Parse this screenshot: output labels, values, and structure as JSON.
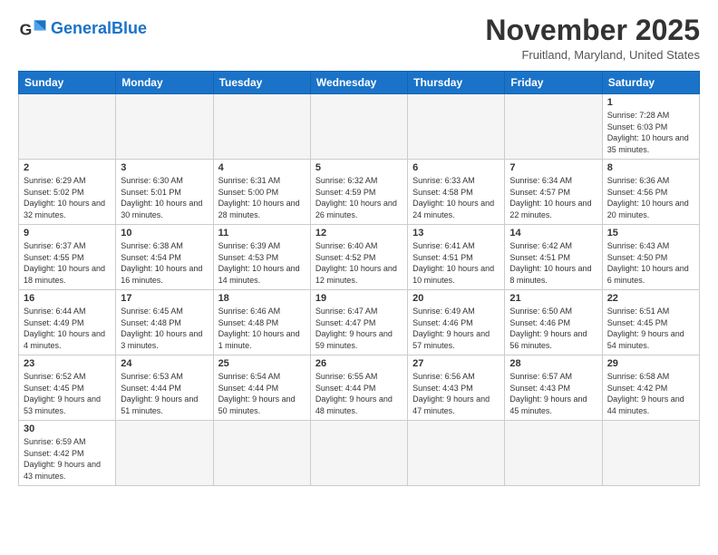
{
  "header": {
    "logo_general": "General",
    "logo_blue": "Blue",
    "month_title": "November 2025",
    "location": "Fruitland, Maryland, United States"
  },
  "weekdays": [
    "Sunday",
    "Monday",
    "Tuesday",
    "Wednesday",
    "Thursday",
    "Friday",
    "Saturday"
  ],
  "weeks": [
    [
      {
        "day": "",
        "info": ""
      },
      {
        "day": "",
        "info": ""
      },
      {
        "day": "",
        "info": ""
      },
      {
        "day": "",
        "info": ""
      },
      {
        "day": "",
        "info": ""
      },
      {
        "day": "",
        "info": ""
      },
      {
        "day": "1",
        "info": "Sunrise: 7:28 AM\nSunset: 6:03 PM\nDaylight: 10 hours\nand 35 minutes."
      }
    ],
    [
      {
        "day": "2",
        "info": "Sunrise: 6:29 AM\nSunset: 5:02 PM\nDaylight: 10 hours\nand 32 minutes."
      },
      {
        "day": "3",
        "info": "Sunrise: 6:30 AM\nSunset: 5:01 PM\nDaylight: 10 hours\nand 30 minutes."
      },
      {
        "day": "4",
        "info": "Sunrise: 6:31 AM\nSunset: 5:00 PM\nDaylight: 10 hours\nand 28 minutes."
      },
      {
        "day": "5",
        "info": "Sunrise: 6:32 AM\nSunset: 4:59 PM\nDaylight: 10 hours\nand 26 minutes."
      },
      {
        "day": "6",
        "info": "Sunrise: 6:33 AM\nSunset: 4:58 PM\nDaylight: 10 hours\nand 24 minutes."
      },
      {
        "day": "7",
        "info": "Sunrise: 6:34 AM\nSunset: 4:57 PM\nDaylight: 10 hours\nand 22 minutes."
      },
      {
        "day": "8",
        "info": "Sunrise: 6:36 AM\nSunset: 4:56 PM\nDaylight: 10 hours\nand 20 minutes."
      }
    ],
    [
      {
        "day": "9",
        "info": "Sunrise: 6:37 AM\nSunset: 4:55 PM\nDaylight: 10 hours\nand 18 minutes."
      },
      {
        "day": "10",
        "info": "Sunrise: 6:38 AM\nSunset: 4:54 PM\nDaylight: 10 hours\nand 16 minutes."
      },
      {
        "day": "11",
        "info": "Sunrise: 6:39 AM\nSunset: 4:53 PM\nDaylight: 10 hours\nand 14 minutes."
      },
      {
        "day": "12",
        "info": "Sunrise: 6:40 AM\nSunset: 4:52 PM\nDaylight: 10 hours\nand 12 minutes."
      },
      {
        "day": "13",
        "info": "Sunrise: 6:41 AM\nSunset: 4:51 PM\nDaylight: 10 hours\nand 10 minutes."
      },
      {
        "day": "14",
        "info": "Sunrise: 6:42 AM\nSunset: 4:51 PM\nDaylight: 10 hours\nand 8 minutes."
      },
      {
        "day": "15",
        "info": "Sunrise: 6:43 AM\nSunset: 4:50 PM\nDaylight: 10 hours\nand 6 minutes."
      }
    ],
    [
      {
        "day": "16",
        "info": "Sunrise: 6:44 AM\nSunset: 4:49 PM\nDaylight: 10 hours\nand 4 minutes."
      },
      {
        "day": "17",
        "info": "Sunrise: 6:45 AM\nSunset: 4:48 PM\nDaylight: 10 hours\nand 3 minutes."
      },
      {
        "day": "18",
        "info": "Sunrise: 6:46 AM\nSunset: 4:48 PM\nDaylight: 10 hours\nand 1 minute."
      },
      {
        "day": "19",
        "info": "Sunrise: 6:47 AM\nSunset: 4:47 PM\nDaylight: 9 hours\nand 59 minutes."
      },
      {
        "day": "20",
        "info": "Sunrise: 6:49 AM\nSunset: 4:46 PM\nDaylight: 9 hours\nand 57 minutes."
      },
      {
        "day": "21",
        "info": "Sunrise: 6:50 AM\nSunset: 4:46 PM\nDaylight: 9 hours\nand 56 minutes."
      },
      {
        "day": "22",
        "info": "Sunrise: 6:51 AM\nSunset: 4:45 PM\nDaylight: 9 hours\nand 54 minutes."
      }
    ],
    [
      {
        "day": "23",
        "info": "Sunrise: 6:52 AM\nSunset: 4:45 PM\nDaylight: 9 hours\nand 53 minutes."
      },
      {
        "day": "24",
        "info": "Sunrise: 6:53 AM\nSunset: 4:44 PM\nDaylight: 9 hours\nand 51 minutes."
      },
      {
        "day": "25",
        "info": "Sunrise: 6:54 AM\nSunset: 4:44 PM\nDaylight: 9 hours\nand 50 minutes."
      },
      {
        "day": "26",
        "info": "Sunrise: 6:55 AM\nSunset: 4:44 PM\nDaylight: 9 hours\nand 48 minutes."
      },
      {
        "day": "27",
        "info": "Sunrise: 6:56 AM\nSunset: 4:43 PM\nDaylight: 9 hours\nand 47 minutes."
      },
      {
        "day": "28",
        "info": "Sunrise: 6:57 AM\nSunset: 4:43 PM\nDaylight: 9 hours\nand 45 minutes."
      },
      {
        "day": "29",
        "info": "Sunrise: 6:58 AM\nSunset: 4:42 PM\nDaylight: 9 hours\nand 44 minutes."
      }
    ],
    [
      {
        "day": "30",
        "info": "Sunrise: 6:59 AM\nSunset: 4:42 PM\nDaylight: 9 hours\nand 43 minutes."
      },
      {
        "day": "",
        "info": ""
      },
      {
        "day": "",
        "info": ""
      },
      {
        "day": "",
        "info": ""
      },
      {
        "day": "",
        "info": ""
      },
      {
        "day": "",
        "info": ""
      },
      {
        "day": "",
        "info": ""
      }
    ]
  ]
}
